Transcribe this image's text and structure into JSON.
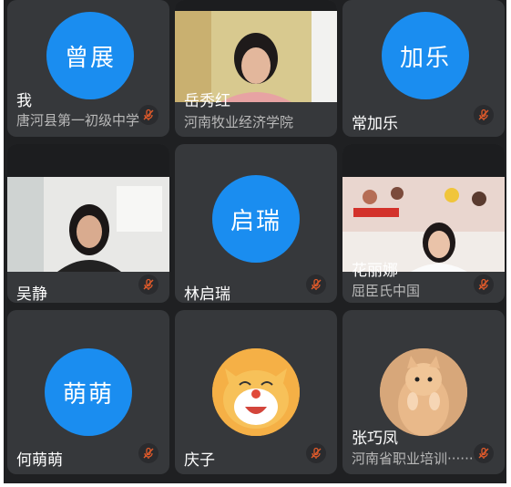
{
  "participants": [
    {
      "name": "我",
      "org": "唐河县第一初级中学",
      "avatar": "曾展"
    },
    {
      "name": "岳秀红",
      "org": "河南牧业经济学院"
    },
    {
      "name": "常加乐",
      "avatar": "加乐"
    },
    {
      "name": "吴静"
    },
    {
      "name": "林启瑞",
      "avatar": "启瑞"
    },
    {
      "name": "花丽娜",
      "org": "屈臣氏中国"
    },
    {
      "name": "何萌萌",
      "avatar": "萌萌"
    },
    {
      "name": "庆子"
    },
    {
      "name": "张巧凤",
      "org": "河南省职业培训······"
    }
  ],
  "colors": {
    "avatar_blue": "#1a8df0",
    "mute_red": "#e05a2a",
    "tile_bg": "#36383b"
  },
  "icons": {
    "mute": "mic-muted-icon"
  }
}
